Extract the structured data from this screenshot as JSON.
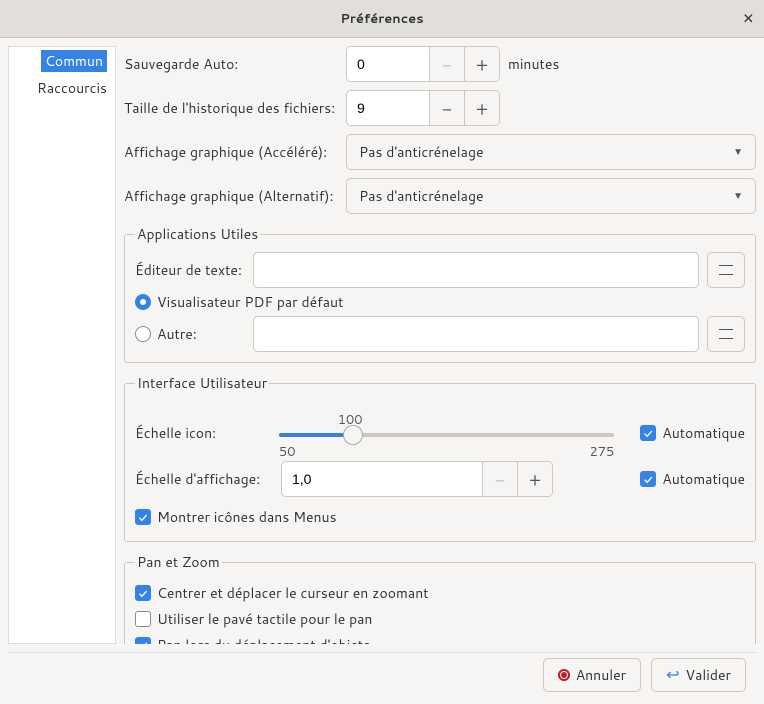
{
  "title": "Préférences",
  "sidebar": {
    "tabs": [
      {
        "label": "Commun",
        "active": true
      },
      {
        "label": "Raccourcis",
        "active": false
      }
    ]
  },
  "general": {
    "autosave_label": "Sauvegarde Auto:",
    "autosave_value": "0",
    "autosave_unit": "minutes",
    "history_label": "Taille de l'historique des fichiers:",
    "history_value": "9",
    "accel_label": "Affichage graphique (Accéléré):",
    "accel_value": "Pas d'anticrénelage",
    "fallback_label": "Affichage graphique (Alternatif):",
    "fallback_value": "Pas d'anticrénelage"
  },
  "apps": {
    "legend": "Applications Utiles",
    "editor_label": "Éditeur de texte:",
    "editor_value": "",
    "pdf_default_label": "Visualisateur PDF par défaut",
    "pdf_other_label": "Autre:",
    "pdf_other_value": "",
    "pdf_mode": "default"
  },
  "ui": {
    "legend": "Interface Utilisateur",
    "iconscale_label": "Échelle icon:",
    "iconscale_value": 100,
    "iconscale_min": 50,
    "iconscale_max": 275,
    "iconscale_auto": true,
    "auto_label": "Automatique",
    "canvasscale_label": "Échelle d'affichage:",
    "canvasscale_value": "1,0",
    "canvasscale_auto": true,
    "menuicons_label": "Montrer icônes dans Menus",
    "menuicons": true
  },
  "panzoom": {
    "legend": "Pan et Zoom",
    "center_label": "Centrer et déplacer le curseur en zoomant",
    "center": true,
    "touchpad_label": "Utiliser le pavé tactile pour le pan",
    "touchpad": false,
    "panmove_label": "Pan lors du déplacement d'objets",
    "panmove": true
  },
  "buttons": {
    "cancel": "Annuler",
    "ok": "Valider"
  }
}
